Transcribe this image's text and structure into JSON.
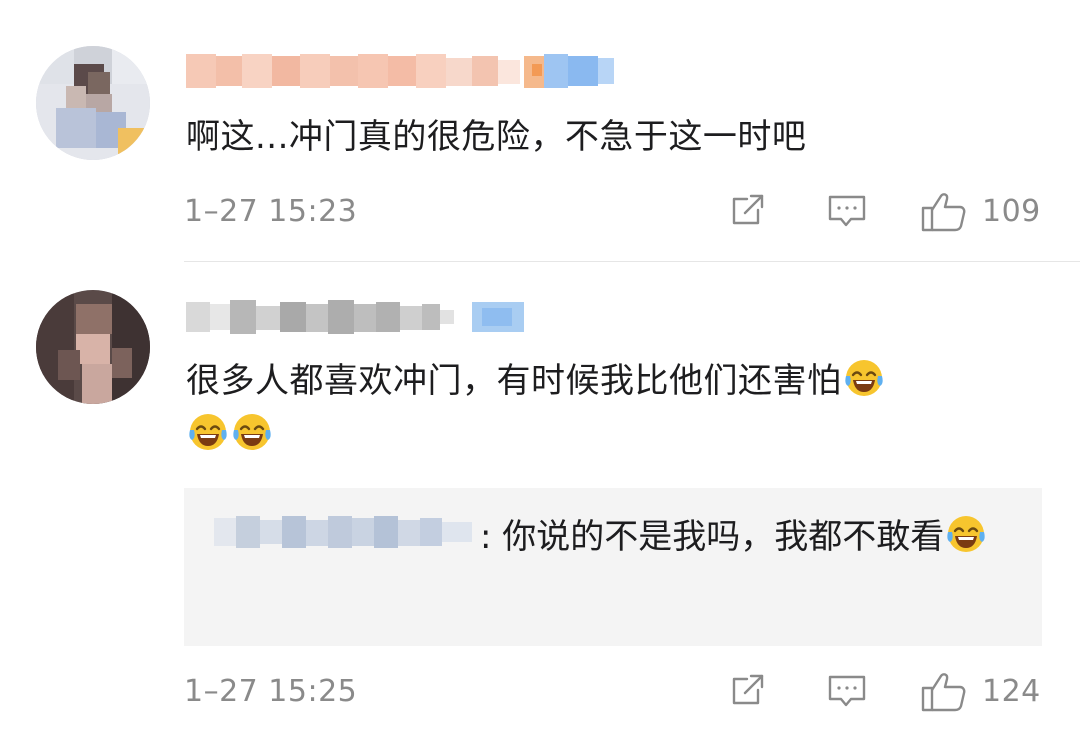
{
  "comments": [
    {
      "text": "啊这...冲门真的很危险，不急于这一时吧",
      "time": "1–27 15:23",
      "likes": "109"
    },
    {
      "text_main": "很多人都喜欢冲门，有时候我比他们还害怕",
      "quote_text": ": 你说的不是我吗，我都不敢看",
      "time": "1–27 15:25",
      "likes": "124"
    }
  ],
  "icons": {
    "share": "share-icon",
    "reply": "comment-icon",
    "like": "thumbs-up-icon",
    "emoji": "laughing-crying-emoji-icon"
  },
  "colors": {
    "meta_text": "#8a8a8a",
    "quote_bg": "#f4f4f4",
    "divider": "#e6e6e6",
    "badge_blue": "#8ab9f0"
  }
}
